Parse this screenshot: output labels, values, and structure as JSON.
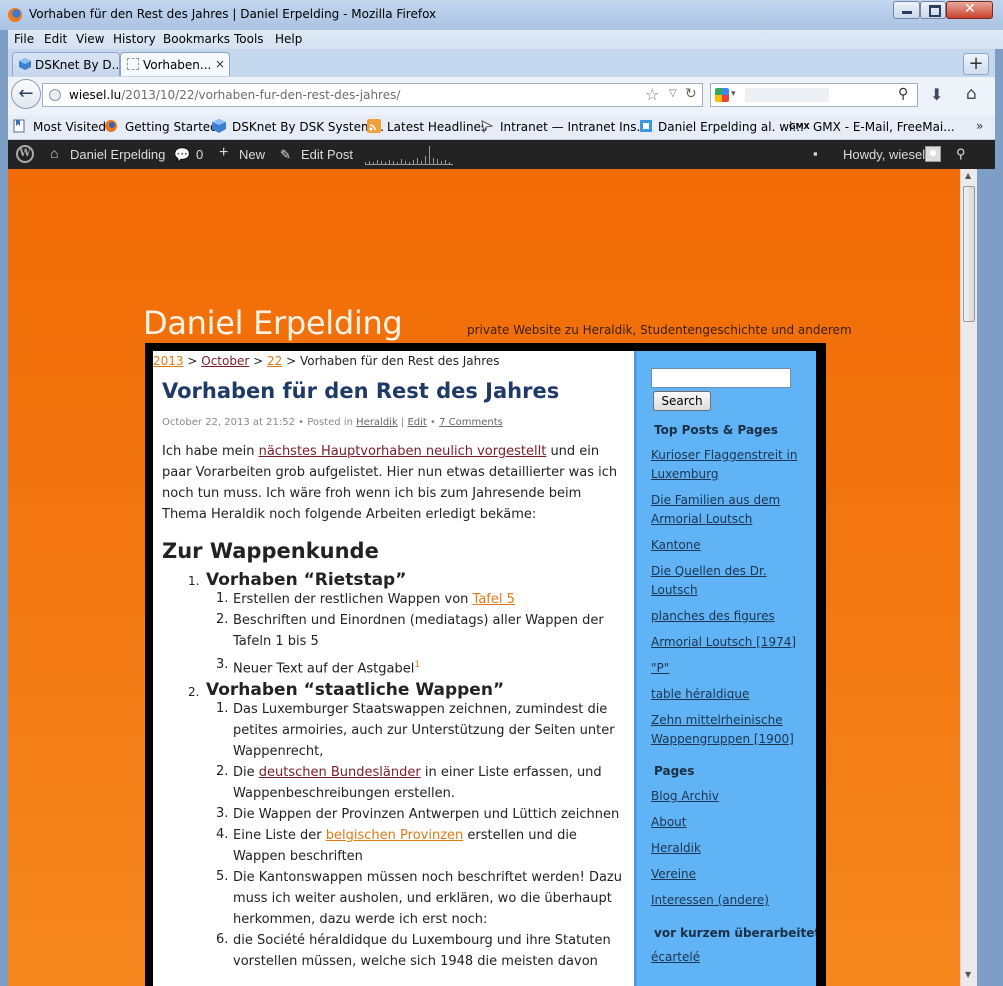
{
  "window": {
    "title": "Vorhaben für den Rest des Jahres | Daniel Erpelding - Mozilla Firefox",
    "menu": [
      "File",
      "Edit",
      "View",
      "History",
      "Bookmarks",
      "Tools",
      "Help"
    ],
    "tabs": [
      {
        "label": "DSKnet By D..."
      },
      {
        "label": "Vorhaben...",
        "close": "×"
      }
    ],
    "new_tab": "+"
  },
  "nav": {
    "url_domain": "wiesel.lu",
    "url_path": "/2013/10/22/vorhaben-fur-den-rest-des-jahres/",
    "search_value": ""
  },
  "bookmarks": [
    {
      "label": "Most Visited",
      "icon": "bookmarks-folder-icon"
    },
    {
      "label": "Getting Started",
      "icon": "firefox-icon"
    },
    {
      "label": "DSKnet By DSK System...",
      "icon": "cube-icon"
    },
    {
      "label": "Latest Headlines",
      "icon": "rss-icon"
    },
    {
      "label": "Intranet — Intranet Ins...",
      "icon": "intranet-icon"
    },
    {
      "label": "Daniel Erpelding al. wi...",
      "icon": "page-icon"
    },
    {
      "label": "GMX - E-Mail, FreeMai...",
      "icon": "gmx-icon"
    }
  ],
  "bookmarks_more": "»",
  "adminbar": {
    "site": "Daniel Erpelding",
    "comments": "0",
    "new": "New",
    "edit": "Edit Post",
    "howdy": "Howdy, wiesel"
  },
  "site": {
    "title": "Daniel Erpelding",
    "description": "private Website zu Heraldik, Studentengeschichte und anderem"
  },
  "breadcrumb": {
    "year": "2013",
    "month": "October",
    "day": "22",
    "sep": ">",
    "current": "Vorhaben für den Rest des Jahres"
  },
  "post": {
    "title": "Vorhaben für den Rest des Jahres",
    "meta_date": "October 22, 2013 at 21:52",
    "meta_posted": "Posted in",
    "meta_category": "Heraldik",
    "meta_edit": "Edit",
    "meta_comments": "7 Comments",
    "intro_1": "Ich habe mein ",
    "intro_link": "nächstes Hauptvorhaben neulich vorgestellt",
    "intro_2": " und ein paar Vorarbeiten grob aufgelistet. Hier nun etwas detaillierter was ich noch tun muss. Ich wäre froh wenn ich bis zum Jahresende beim Thema Heraldik noch folgende Arbeiten erledigt bekäme:",
    "heading": "Zur Wappenkunde",
    "list1_title": "Vorhaben “Rietstap”",
    "list1": [
      {
        "pre": "Erstellen der restlichen Wappen von ",
        "link": "Tafel 5",
        "post": ""
      },
      {
        "pre": "Beschriften und Einordnen (mediatags) aller Wappen der Tafeln 1 bis 5",
        "link": "",
        "post": ""
      },
      {
        "pre": "Neuer Text auf der Astgabel",
        "link": "",
        "post": "",
        "sup": "1"
      }
    ],
    "list2_title": "Vorhaben “staatliche Wappen”",
    "list2": [
      {
        "pre": "Das Luxemburger Staatswappen zeichnen, zumindest die petites armoiries, auch zur Unterstützung der Seiten unter Wappenrecht,",
        "link": "",
        "post": ""
      },
      {
        "pre": "Die ",
        "link": "deutschen Bundesländer",
        "post": " in einer Liste erfassen, und Wappenbeschreibungen erstellen."
      },
      {
        "pre": "Die Wappen der Provinzen Antwerpen und Lüttich zeichnen",
        "link": "",
        "post": ""
      },
      {
        "pre": "Eine Liste der ",
        "link": "belgischen Provinzen",
        "post": " erstellen und die Wappen beschriften"
      },
      {
        "pre": "Die Kantonswappen müssen noch beschriftet werden! Dazu muss ich weiter ausholen, und erklären, wo die überhaupt herkommen, dazu werde ich erst noch:",
        "link": "",
        "post": ""
      },
      {
        "pre": "die Société héraldidque du Luxembourg und ihre Statuten vorstellen müssen, welche sich 1948 die meisten davon",
        "link": "",
        "post": ""
      }
    ]
  },
  "sidebar": {
    "search_value": "",
    "search_button": "Search",
    "top_heading": "Top Posts & Pages",
    "top_posts": [
      "Kurioser Flaggenstreit in Luxemburg",
      "Die Familien aus dem Armorial Loutsch",
      "Kantone",
      "Die Quellen des Dr. Loutsch",
      "planches des figures",
      "Armorial Loutsch [1974]",
      "\"P\"",
      "table héraldique",
      "Zehn mittelrheinische Wappengruppen [1900]"
    ],
    "pages_heading": "Pages",
    "pages": [
      "Blog Archiv",
      "About",
      "Heraldik",
      "Vereine",
      "Interessen (andere)"
    ],
    "recent_heading": "vor kurzem überarbeitet",
    "recent": [
      "écartelé"
    ]
  }
}
